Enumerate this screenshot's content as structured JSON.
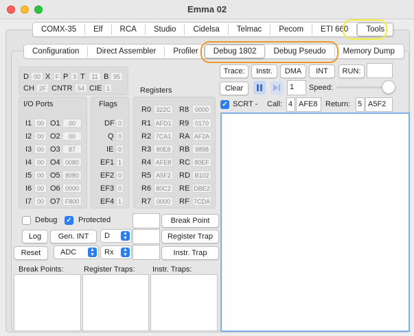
{
  "window": {
    "title": "Emma 02"
  },
  "main_tabs": [
    {
      "label": "COMX-35"
    },
    {
      "label": "Elf"
    },
    {
      "label": "RCA"
    },
    {
      "label": "Studio"
    },
    {
      "label": "Cidelsa"
    },
    {
      "label": "Telmac"
    },
    {
      "label": "Pecom"
    },
    {
      "label": "ETI 660"
    },
    {
      "label": "Tools"
    }
  ],
  "sub_tabs": [
    {
      "label": "Configuration"
    },
    {
      "label": "Direct Assembler"
    },
    {
      "label": "Profiler"
    },
    {
      "label": "Debug 1802"
    },
    {
      "label": "Debug Pseudo"
    },
    {
      "label": "Memory Dump"
    }
  ],
  "colors": {
    "tools_ring": "#f2ec3a",
    "debug_ring": "#f0962a",
    "accent": "#2a7ef5"
  },
  "status_regs": {
    "row1": [
      {
        "name": "D",
        "value": "00"
      },
      {
        "name": "X",
        "value": "F"
      },
      {
        "name": "P",
        "value": "3"
      },
      {
        "name": "T",
        "value": "11"
      },
      {
        "name": "B",
        "value": "95"
      }
    ],
    "row2": [
      {
        "name": "CH",
        "value": "2F"
      },
      {
        "name": "CNTR",
        "value": "54"
      },
      {
        "name": "CIE",
        "value": "1"
      }
    ]
  },
  "io_ports": {
    "title": "I/O Ports",
    "inputs": [
      {
        "name": "I1",
        "value": "00"
      },
      {
        "name": "I2",
        "value": "00"
      },
      {
        "name": "I3",
        "value": "00"
      },
      {
        "name": "I4",
        "value": "00"
      },
      {
        "name": "I5",
        "value": "00"
      },
      {
        "name": "I6",
        "value": "00"
      },
      {
        "name": "I7",
        "value": "00"
      }
    ],
    "outputs": [
      {
        "name": "O1",
        "value": "00"
      },
      {
        "name": "O2",
        "value": "00"
      },
      {
        "name": "O3",
        "value": "87"
      },
      {
        "name": "O4",
        "value": "0080"
      },
      {
        "name": "O5",
        "value": "8080"
      },
      {
        "name": "O6",
        "value": "0000"
      },
      {
        "name": "O7",
        "value": "F800"
      }
    ]
  },
  "flags": {
    "title": "Flags",
    "items": [
      {
        "name": "DF",
        "value": "0"
      },
      {
        "name": "Q",
        "value": "0"
      },
      {
        "name": "IE",
        "value": "0"
      },
      {
        "name": "EF1",
        "value": "1"
      },
      {
        "name": "EF2",
        "value": "0"
      },
      {
        "name": "EF3",
        "value": "0"
      },
      {
        "name": "EF4",
        "value": "1"
      }
    ]
  },
  "registers": {
    "title": "Registers",
    "left": [
      {
        "name": "R0",
        "value": "322C"
      },
      {
        "name": "R1",
        "value": "AFD1"
      },
      {
        "name": "R2",
        "value": "7CA1"
      },
      {
        "name": "R3",
        "value": "80E8"
      },
      {
        "name": "R4",
        "value": "AFE8"
      },
      {
        "name": "R5",
        "value": "A5F2"
      },
      {
        "name": "R6",
        "value": "80C2"
      },
      {
        "name": "R7",
        "value": "0000"
      }
    ],
    "right": [
      {
        "name": "R8",
        "value": "0000"
      },
      {
        "name": "R9",
        "value": "0170"
      },
      {
        "name": "RA",
        "value": "AF2A"
      },
      {
        "name": "RB",
        "value": "9898"
      },
      {
        "name": "RC",
        "value": "80EF"
      },
      {
        "name": "RD",
        "value": "B102"
      },
      {
        "name": "RE",
        "value": "DBE2"
      },
      {
        "name": "RF",
        "value": "7CDA"
      }
    ]
  },
  "controls": {
    "debug_label": "Debug",
    "protected_label": "Protected",
    "breakpoint_btn": "Break Point",
    "log_btn": "Log",
    "gen_int_btn": "Gen. INT",
    "reg_select": "D",
    "register_trap_btn": "Register Trap",
    "reset_btn": "Reset",
    "adc_select": "ADC",
    "rx_select": "Rx",
    "instr_trap_btn": "Instr. Trap"
  },
  "lists": {
    "breakpoints": "Break Points:",
    "register_traps": "Register Traps:",
    "instr_traps": "Instr. Traps:"
  },
  "trace": {
    "trace_btn": "Trace:",
    "instr_btn": "Instr.",
    "dma_btn": "DMA",
    "int_btn": "INT",
    "run_label": "RUN:",
    "clear_btn": "Clear",
    "step_value": "1",
    "speed_label": "Speed:",
    "scrt_label": "SCRT -",
    "call_label": "Call:",
    "call_reg": "4",
    "call_value": "AFE8",
    "return_label": "Return:",
    "return_reg": "5",
    "return_value": "A5F2"
  }
}
